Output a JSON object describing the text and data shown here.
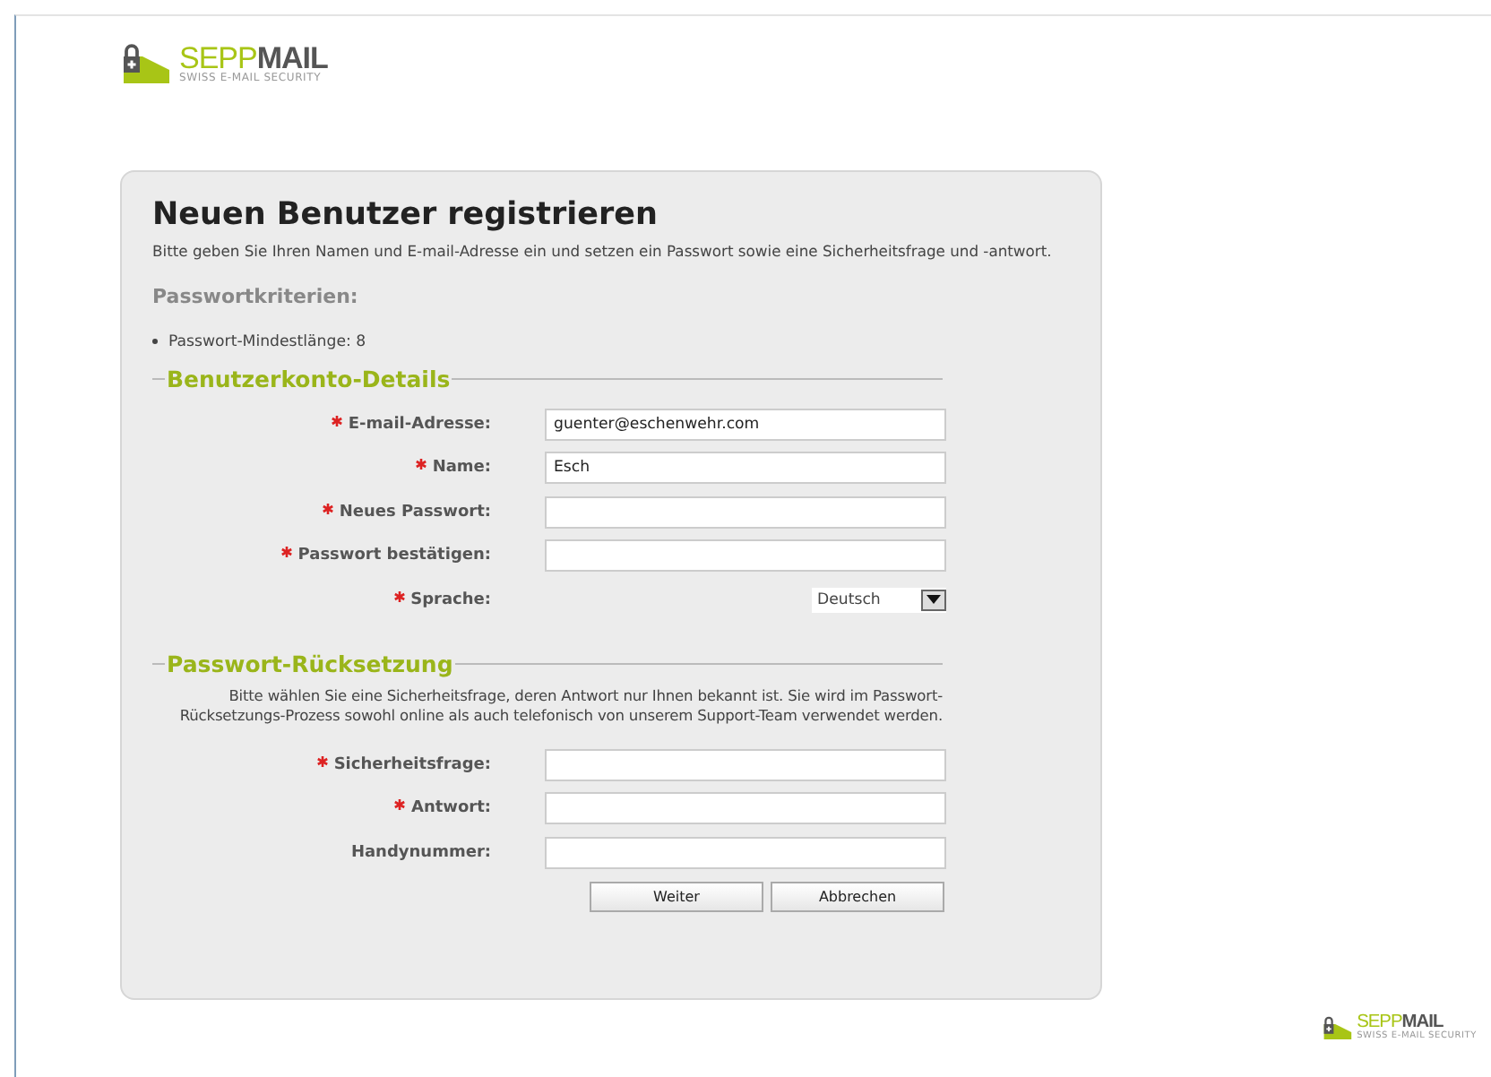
{
  "header": {
    "logo": "SEPP**MAIL**",
    "tagline": "SWISS E-MAIL SECURITY"
  },
  "form": {
    "title": "Neuen Benutzer registrieren",
    "intro": "Bitte geben Sie Ihren Namen und E-mail-Adresse ein und setzen ein Passwort sowie eine Sicherheitsfrage und -antwort.",
    "criteria_heading": "Passwortkriterien:",
    "criteria": [
      "Passwort-Mindestlänge: 8"
    ],
    "sections": [
      {
        "legend": "Benutzerkonto-Details",
        "fields": [
          {
            "kind": "input",
            "label": "E-mail-Adresse:",
            "required": true,
            "value": "guenter@eschenwehr.com"
          },
          {
            "kind": "input",
            "label": "Name:",
            "required": true,
            "value": "Esch"
          },
          {
            "kind": "input",
            "label": "Neues Passwort:",
            "required": true
          },
          {
            "kind": "input",
            "label": "Passwort bestätigen:",
            "required": true
          },
          {
            "kind": "select",
            "label": "Sprache:",
            "required": true,
            "value": "Deutsch"
          }
        ]
      },
      {
        "legend": "Passwort-Rücksetzung",
        "note": "Bitte wählen Sie eine Sicherheitsfrage, deren Antwort nur Ihnen bekannt ist. Sie wird im Passwort-Rücksetzungs-Prozess sowohl online als auch telefonisch von unserem Support-Team verwendet werden.",
        "fields": [
          {
            "kind": "input",
            "label": "Sicherheitsfrage:",
            "required": true
          },
          {
            "kind": "input",
            "label": "Antwort:",
            "required": true
          },
          {
            "kind": "input",
            "label": "Handynummer:",
            "required": false
          }
        ]
      }
    ],
    "buttons": [
      "Weiter",
      "Abbrechen"
    ]
  },
  "footer": {
    "logo": "SEPP**MAIL**",
    "tagline": "SWISS E-MAIL SECURITY"
  }
}
